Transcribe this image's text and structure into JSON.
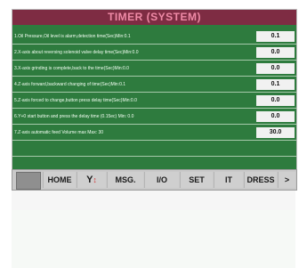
{
  "title": "TIMER (SYSTEM)",
  "rows": [
    {
      "label": "1.Oil Pressure,Oil level is alarm,detection time(Sec)Min:0.1",
      "value": "0.1"
    },
    {
      "label": "2.X-axis about reversing solenoid valve delay time(Sec)Min:0.0",
      "value": "0.0"
    },
    {
      "label": "3.X-axis grinding is complete,back to the time(Sec)Min:0.0",
      "value": "0.0"
    },
    {
      "label": "4.Z-axis forward,backward changing of time(Sec)Min:0.1",
      "value": "0.1"
    },
    {
      "label": "5.Z-axis forced to change,button press delay time(Sec)Min:0.0",
      "value": "0.0"
    },
    {
      "label": "6.Y+0 start button and press the delay time (0.15ec) Min: 0.0",
      "value": "0.0"
    },
    {
      "label": "7.Z-axis automatic feed Volume max  Max: 30",
      "value": "30.0"
    }
  ],
  "nav": {
    "home": "HOME",
    "y_icon": "Y",
    "msg": "MSG.",
    "io": "I/O",
    "set": "SET",
    "it": "IT",
    "dress": "DRESS",
    "next": ">"
  },
  "colors": {
    "title_bg": "#7e2c43",
    "title_text": "#ef8aa6",
    "panel_bg": "#2e7b3e",
    "nav_bg": "#c9c9c9"
  }
}
